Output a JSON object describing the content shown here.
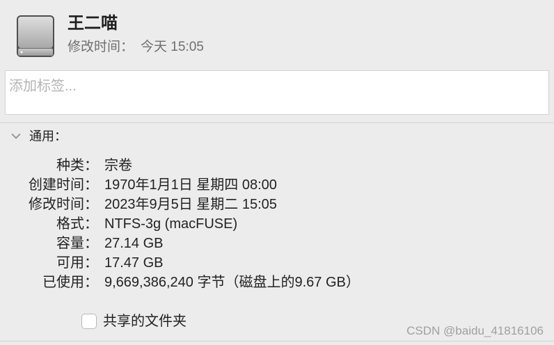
{
  "colors": {
    "window_background": "#ececec",
    "text": "#222222",
    "secondary_text": "#6f6f6f",
    "placeholder": "#b4b4b4"
  },
  "header": {
    "icon": "external-drive-icon",
    "title": "王二喵",
    "modified_label": "修改时间：",
    "modified_value": "今天 15:05"
  },
  "tags": {
    "placeholder": "添加标签..."
  },
  "general": {
    "toggle_icon": "chevron-down-icon",
    "label": "通用：",
    "expanded": true,
    "rows": [
      {
        "label": "种类：",
        "value": "宗卷"
      },
      {
        "label": "创建时间：",
        "value": "1970年1月1日 星期四 08:00"
      },
      {
        "label": "修改时间：",
        "value": "2023年9月5日 星期二 15:05"
      },
      {
        "label": "格式：",
        "value": "NTFS-3g (macFUSE)"
      },
      {
        "label": "容量：",
        "value": "27.14 GB"
      },
      {
        "label": "可用：",
        "value": "17.47 GB"
      },
      {
        "label": "已使用：",
        "value": "9,669,386,240 字节（磁盘上的9.67 GB）"
      }
    ]
  },
  "sharing": {
    "checkbox_label": "共享的文件夹",
    "checked": false
  },
  "watermark": "CSDN @baidu_41816106"
}
